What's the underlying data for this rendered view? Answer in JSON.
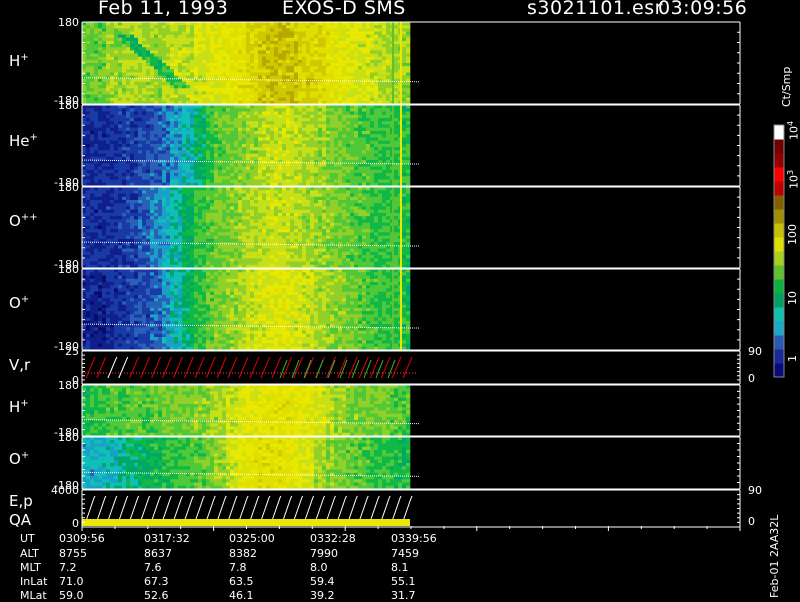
{
  "header": {
    "date": "Feb 11, 1993",
    "instrument": "EXOS-D SMS",
    "file": "s3021101.esr",
    "time": "03:09:56"
  },
  "colorbar": {
    "unit": "Ct/Smp",
    "scale": "log",
    "labels": [
      "1",
      "10",
      "100",
      "10^3",
      "10^4"
    ],
    "colors": [
      "#0a0a7a",
      "#1a2a9a",
      "#2a5ab0",
      "#1ca8c8",
      "#10c0b0",
      "#00a060",
      "#10b040",
      "#60c030",
      "#a8d020",
      "#e0e000",
      "#c8c000",
      "#a09000",
      "#806000",
      "#c00000",
      "#ff0000",
      "#900000",
      "#700000",
      "#ffffff"
    ]
  },
  "panels": [
    {
      "label": "H",
      "charge": "+",
      "ymax": "180",
      "ymin": "-180",
      "right_top": "",
      "right_bottom": ""
    },
    {
      "label": "He",
      "charge": "+",
      "ymax": "180",
      "ymin": "-180",
      "right_top": "",
      "right_bottom": ""
    },
    {
      "label": "O",
      "charge": "++",
      "ymax": "180",
      "ymin": "-180",
      "right_top": "",
      "right_bottom": ""
    },
    {
      "label": "O",
      "charge": "+",
      "ymax": "180",
      "ymin": "-180",
      "right_top": "",
      "right_bottom": ""
    },
    {
      "label": "V,r",
      "charge": "",
      "ymax": "25",
      "ymin": "0",
      "right_top": "90",
      "right_bottom": "0"
    },
    {
      "label": "H",
      "charge": "+",
      "ymax": "180",
      "ymin": "-180",
      "right_top": "",
      "right_bottom": ""
    },
    {
      "label": "O",
      "charge": "+",
      "ymax": "180",
      "ymin": "-180",
      "right_top": "",
      "right_bottom": ""
    },
    {
      "label": "E,p",
      "label2": "QA",
      "charge": "",
      "ymax": "4000",
      "ymin": "0",
      "right_top": "90",
      "right_bottom": "0"
    }
  ],
  "orbit": {
    "row_labels": [
      "UT",
      "ALT",
      "MLT",
      "InLat",
      "MLat"
    ],
    "columns": [
      [
        "0309:56",
        "8755",
        "7.2",
        "71.0",
        "59.0"
      ],
      [
        "0317:32",
        "8637",
        "7.6",
        "67.3",
        "52.6"
      ],
      [
        "0325:00",
        "8382",
        "7.8",
        "63.5",
        "46.1"
      ],
      [
        "0332:28",
        "7990",
        "8.0",
        "59.4",
        "39.2"
      ],
      [
        "0339:56",
        "7459",
        "8.1",
        "55.1",
        "31.7"
      ]
    ]
  },
  "footer": "Feb-01 2AA32L",
  "chart_data": {
    "type": "heatmap",
    "title": "Feb 11, 1993   EXOS-D SMS",
    "x_axis": {
      "label": "UT",
      "ticks": [
        "0309:56",
        "0317:32",
        "0325:00",
        "0332:28",
        "0339:56"
      ]
    },
    "colorbar_unit": "Ct/Smp",
    "colorbar_range": [
      1,
      10000
    ],
    "series": [
      {
        "name": "H+",
        "ylim": [
          -180,
          180
        ],
        "profile": [
          0.55,
          0.55,
          0.6,
          0.6,
          0.62,
          0.62,
          0.6,
          0.62,
          0.65,
          0.65,
          0.68,
          0.7,
          0.72,
          0.74,
          0.76,
          0.8,
          0.84,
          0.86,
          0.86,
          0.84,
          0.82,
          0.8,
          0.76,
          0.72,
          0.7,
          0.68,
          0.66,
          0.64,
          0.62,
          0.6
        ]
      },
      {
        "name": "He+",
        "ylim": [
          -180,
          180
        ],
        "profile": [
          0.12,
          0.12,
          0.12,
          0.14,
          0.15,
          0.18,
          0.2,
          0.22,
          0.28,
          0.34,
          0.42,
          0.5,
          0.54,
          0.56,
          0.58,
          0.6,
          0.64,
          0.66,
          0.66,
          0.64,
          0.62,
          0.6,
          0.58,
          0.56,
          0.54,
          0.52,
          0.5,
          0.5,
          0.5,
          0.48
        ]
      },
      {
        "name": "O++",
        "ylim": [
          -180,
          180
        ],
        "profile": [
          0.12,
          0.12,
          0.13,
          0.14,
          0.16,
          0.2,
          0.26,
          0.3,
          0.36,
          0.44,
          0.5,
          0.54,
          0.56,
          0.58,
          0.6,
          0.62,
          0.64,
          0.66,
          0.66,
          0.64,
          0.62,
          0.6,
          0.58,
          0.56,
          0.54,
          0.52,
          0.5,
          0.5,
          0.5,
          0.48
        ]
      },
      {
        "name": "O+",
        "ylim": [
          -180,
          180
        ],
        "profile": [
          0.1,
          0.1,
          0.12,
          0.14,
          0.16,
          0.18,
          0.22,
          0.28,
          0.34,
          0.42,
          0.5,
          0.54,
          0.58,
          0.6,
          0.62,
          0.66,
          0.68,
          0.7,
          0.7,
          0.68,
          0.66,
          0.62,
          0.6,
          0.58,
          0.56,
          0.54,
          0.52,
          0.5,
          0.5,
          0.48
        ]
      },
      {
        "name": "V,r",
        "ylim": [
          0,
          25
        ],
        "right_ylim": [
          0,
          90
        ]
      },
      {
        "name": "H+ (2)",
        "ylim": [
          -180,
          180
        ],
        "profile": [
          0.48,
          0.5,
          0.52,
          0.5,
          0.54,
          0.52,
          0.54,
          0.56,
          0.56,
          0.56,
          0.58,
          0.6,
          0.62,
          0.66,
          0.7,
          0.72,
          0.74,
          0.76,
          0.76,
          0.74,
          0.72,
          0.68,
          0.64,
          0.6,
          0.58,
          0.56,
          0.56,
          0.56,
          0.54,
          0.52
        ]
      },
      {
        "name": "O+ (2)",
        "ylim": [
          -180,
          180
        ],
        "profile": [
          0.3,
          0.32,
          0.34,
          0.36,
          0.4,
          0.42,
          0.46,
          0.48,
          0.5,
          0.52,
          0.54,
          0.56,
          0.6,
          0.66,
          0.72,
          0.76,
          0.78,
          0.78,
          0.76,
          0.72,
          0.68,
          0.62,
          0.58,
          0.56,
          0.54,
          0.52,
          0.5,
          0.5,
          0.48,
          0.46
        ]
      },
      {
        "name": "E,p / QA",
        "ylim": [
          0,
          4000
        ],
        "right_ylim": [
          0,
          90
        ]
      }
    ]
  }
}
